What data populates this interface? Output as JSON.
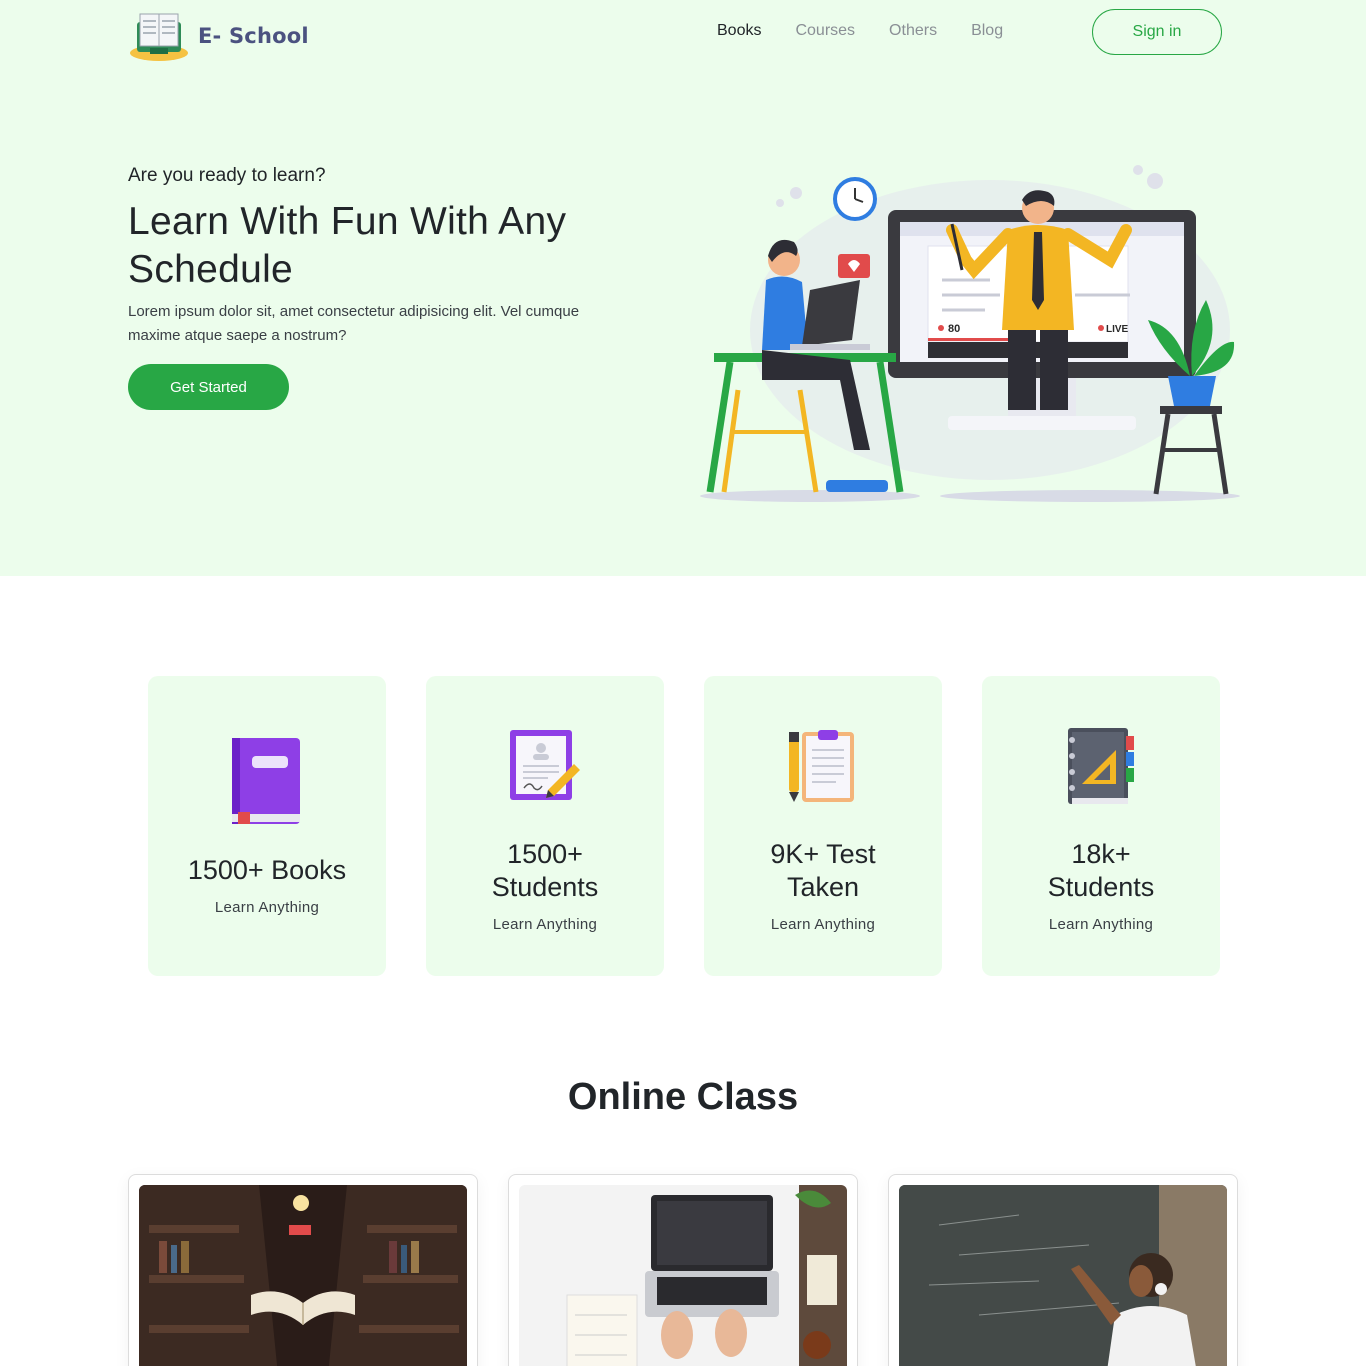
{
  "brand": {
    "name": "E- School",
    "logo_icon": "open-book-icon"
  },
  "nav": {
    "items": [
      {
        "label": "Books",
        "active": true
      },
      {
        "label": "Courses",
        "active": false
      },
      {
        "label": "Others",
        "active": false
      },
      {
        "label": "Blog",
        "active": false
      }
    ],
    "signin_label": "Sign in"
  },
  "hero": {
    "eyebrow": "Are you ready to learn?",
    "title": "Learn With Fun With Any Schedule",
    "description": "Lorem ipsum dolor sit, amet consectetur adipisicing elit. Vel cumque maxime atque saepe a nostrum?",
    "cta_label": "Get Started",
    "illustration": {
      "viewer_count": "80",
      "live_badge": "LIVE"
    }
  },
  "stats": [
    {
      "value": "1500+ Books",
      "subtitle": "Learn Anything",
      "icon": "book-icon"
    },
    {
      "value": "1500+ Students",
      "subtitle": "Learn Anything",
      "icon": "certificate-icon"
    },
    {
      "value": "9K+ Test Taken",
      "subtitle": "Learn Anything",
      "icon": "clipboard-icon"
    },
    {
      "value": "18k+ Students",
      "subtitle": "Learn Anything",
      "icon": "notebook-icon"
    }
  ],
  "online_class": {
    "title": "Online Class",
    "cards": [
      {
        "image": "library-image"
      },
      {
        "image": "laptop-desk-image"
      },
      {
        "image": "blackboard-student-image"
      }
    ]
  },
  "colors": {
    "primary": "#28a745",
    "hero_bg": "#ecfdec",
    "brand_text": "#4b5280"
  }
}
